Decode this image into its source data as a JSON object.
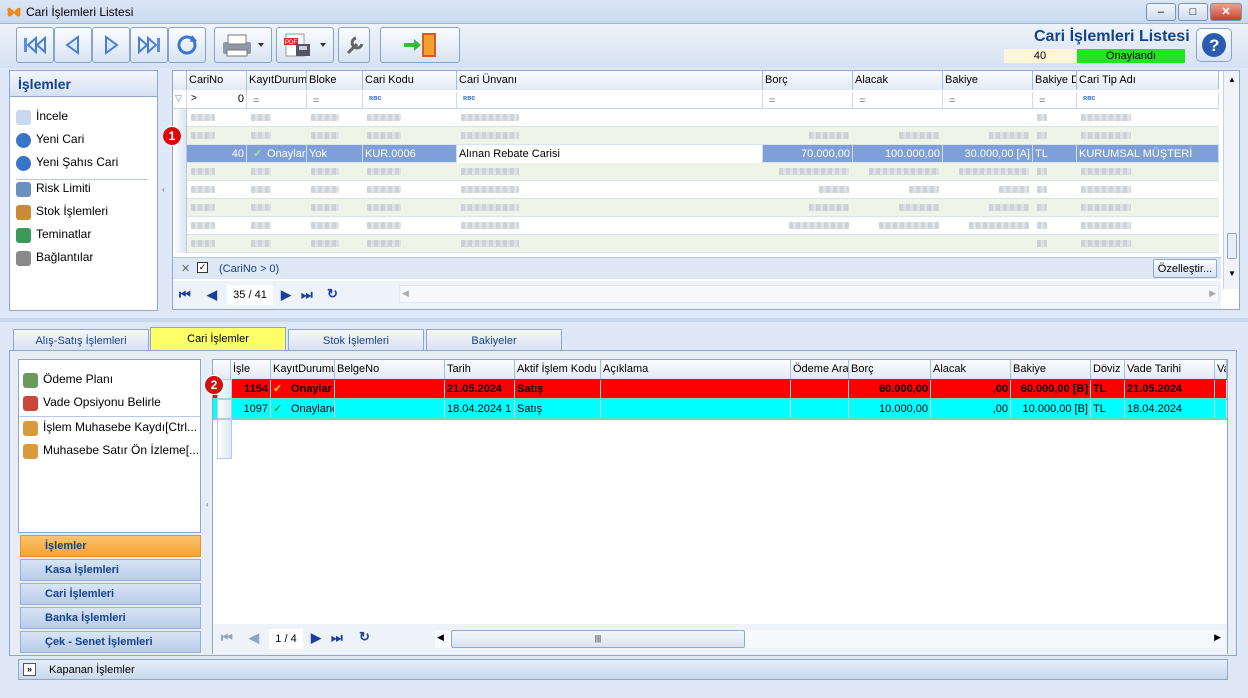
{
  "window": {
    "title": "Cari İşlemleri Listesi"
  },
  "header": {
    "title": "Cari İşlemleri Listesi",
    "count": "40",
    "status": "Onaylandı"
  },
  "colors": {
    "accent": "#15428b",
    "status_green": "#22e322",
    "selected_row": "#7f9fd8",
    "red_row": "#ff0000",
    "cyan_row": "#00ffff",
    "active_tab": "#ffff66",
    "active_group": "#f9a93e"
  },
  "left_menu": {
    "title": "İşlemler",
    "items": [
      {
        "label": "İncele",
        "icon": "document-icon"
      },
      {
        "label": "Yeni Cari",
        "icon": "plus-circle-icon"
      },
      {
        "label": "Yeni Şahıs Cari",
        "icon": "plus-circle-icon"
      },
      {
        "label": "Risk Limiti",
        "icon": "chart-icon"
      },
      {
        "label": "Stok İşlemleri",
        "icon": "box-icon"
      },
      {
        "label": "Teminatlar",
        "icon": "certificate-icon"
      },
      {
        "label": "Bağlantılar",
        "icon": "link-doc-icon"
      }
    ]
  },
  "top_grid": {
    "columns": [
      "CariNo",
      "KayıtDurumu",
      "Bloke",
      "Cari Kodu",
      "Cari Ünvanı",
      "Borç",
      "Alacak",
      "Bakiye",
      "Bakiye D",
      "Cari Tip Adı"
    ],
    "filter_row": {
      "carino": "0"
    },
    "selected": {
      "carino": "40",
      "durum": "Onaylar",
      "bloke": "Yok",
      "kod": "KUR.0006",
      "unvan": "Alınan Rebate Carisi",
      "borc": "70.000,00",
      "alacak": "100.000,00",
      "bakiye": "30.000,00 [A]",
      "doviz": "TL",
      "tip": "KURUMSAL MÜŞTERİ"
    },
    "filter_text": "(CariNo > 0)",
    "customize_label": "Özelleştir...",
    "page": "35 / 41",
    "badge": "1"
  },
  "tabs": [
    "Alış-Satış İşlemleri",
    "Cari İşlemler",
    "Stok İşlemleri",
    "Bakiyeler"
  ],
  "side_menu": {
    "items": [
      {
        "label": "Ödeme Planı"
      },
      {
        "label": "Vade Opsiyonu Belirle"
      },
      {
        "label": "İşlem Muhasebe Kaydı[Ctrl..."
      },
      {
        "label": "Muhasebe Satır Ön İzleme[..."
      }
    ],
    "groups": [
      "İşlemler",
      "Kasa İşlemleri",
      "Cari İşlemleri",
      "Banka İşlemleri",
      "Çek - Senet İşlemleri"
    ]
  },
  "bottom_grid": {
    "columns": [
      "İşle",
      "KayıtDurumu",
      "BelgeNo",
      "Tarih",
      "Aktif İşlem Kodu",
      "Açıklama",
      "Ödeme Ara",
      "Borç",
      "Alacak",
      "Bakiye",
      "Döviz",
      "Vade Tarihi",
      "Va"
    ],
    "rows": [
      {
        "no": "1154",
        "durum": "Onaylar",
        "tarih": "21.05.2024",
        "kod": "Satış",
        "borc": "60.000,00",
        "alacak": ",00",
        "bakiye": "60.000,00 [B]",
        "doviz": "TL",
        "vade": "21.05.2024"
      },
      {
        "no": "1097",
        "durum": "Onaylanc",
        "tarih": "18.04.2024 1",
        "kod": "Satış",
        "borc": "10.000,00",
        "alacak": ",00",
        "bakiye": "10.000,00 [B]",
        "doviz": "TL",
        "vade": "18.04.2024"
      }
    ],
    "page": "1 / 4",
    "badge": "2"
  },
  "footer": {
    "label": "Kapanan İşlemler"
  }
}
